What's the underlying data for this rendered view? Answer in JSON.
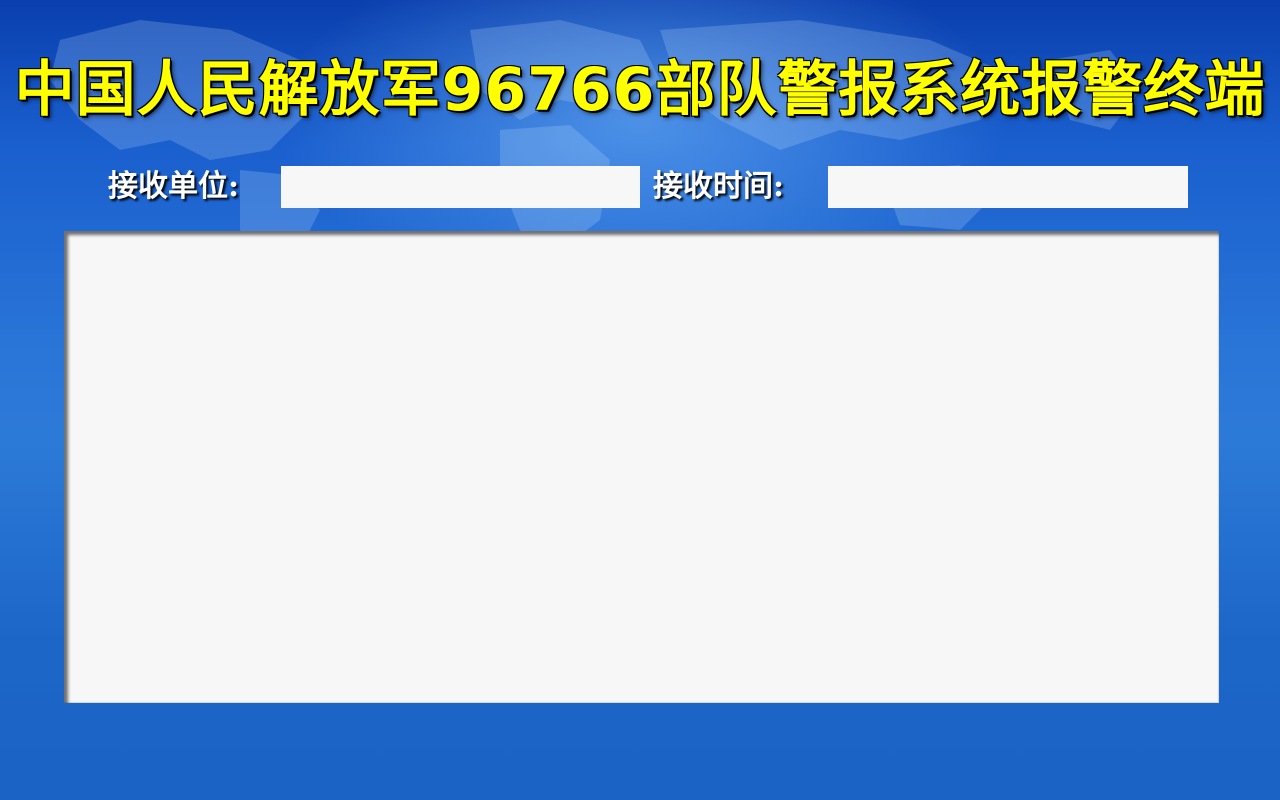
{
  "header": {
    "title": "中国人民解放军96766部队警报系统报警终端"
  },
  "fields": {
    "receive_unit": {
      "label": "接收单位:",
      "value": ""
    },
    "receive_time": {
      "label": "接收时间:",
      "value": ""
    }
  },
  "message_area": {
    "content": ""
  },
  "colors": {
    "background_blue": "#1b64c6",
    "title_yellow": "#ffff00",
    "field_background": "#f7f7f7",
    "label_white": "#ffffff"
  }
}
